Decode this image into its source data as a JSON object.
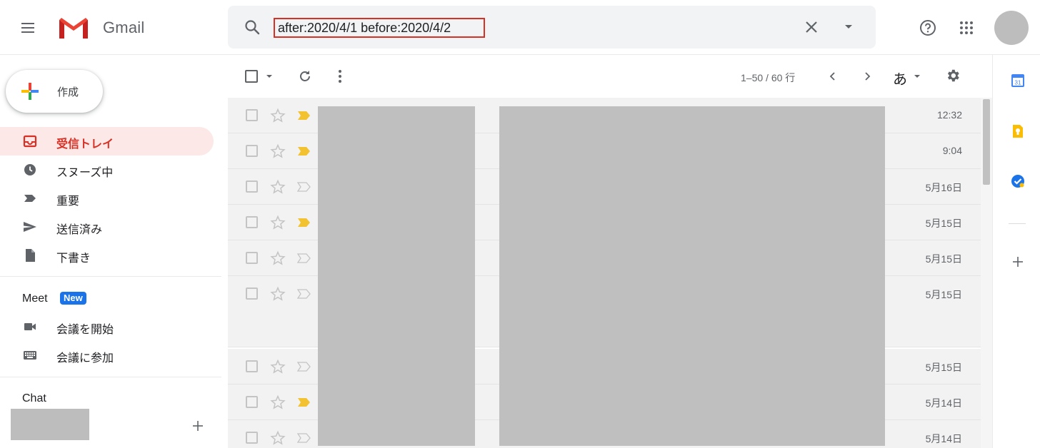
{
  "app": {
    "name": "Gmail"
  },
  "search": {
    "value": "after:2020/4/1 before:2020/4/2"
  },
  "compose": {
    "label": "作成"
  },
  "nav": [
    {
      "label": "受信トレイ",
      "icon": "inbox-icon",
      "active": true
    },
    {
      "label": "スヌーズ中",
      "icon": "clock-icon",
      "active": false
    },
    {
      "label": "重要",
      "icon": "important-icon",
      "active": false
    },
    {
      "label": "送信済み",
      "icon": "send-icon",
      "active": false
    },
    {
      "label": "下書き",
      "icon": "draft-icon",
      "active": false
    }
  ],
  "meet": {
    "title": "Meet",
    "badge": "New",
    "items": [
      {
        "label": "会議を開始",
        "icon": "video-icon"
      },
      {
        "label": "会議に参加",
        "icon": "keyboard-icon"
      }
    ]
  },
  "chat": {
    "title": "Chat"
  },
  "toolbar": {
    "count": "1–50 / 60 行",
    "lang": "あ"
  },
  "emails": [
    {
      "date": "12:32",
      "important": true
    },
    {
      "date": "9:04",
      "important": true
    },
    {
      "date": "5月16日",
      "important": false
    },
    {
      "date": "5月15日",
      "important": true
    },
    {
      "date": "5月15日",
      "important": false
    },
    {
      "date": "5月15日",
      "important": false
    },
    {
      "date": "5月15日",
      "important": false
    },
    {
      "date": "5月14日",
      "important": true
    },
    {
      "date": "5月14日",
      "important": false
    }
  ],
  "side_panel": {
    "calendar_day": "31",
    "icons": [
      "calendar-icon",
      "keep-icon",
      "tasks-icon",
      "add-icon"
    ]
  },
  "colors": {
    "accent_red": "#d93025",
    "active_bg": "#fce8e6",
    "badge_blue": "#1a73e8",
    "important_yellow": "#f2c230"
  }
}
